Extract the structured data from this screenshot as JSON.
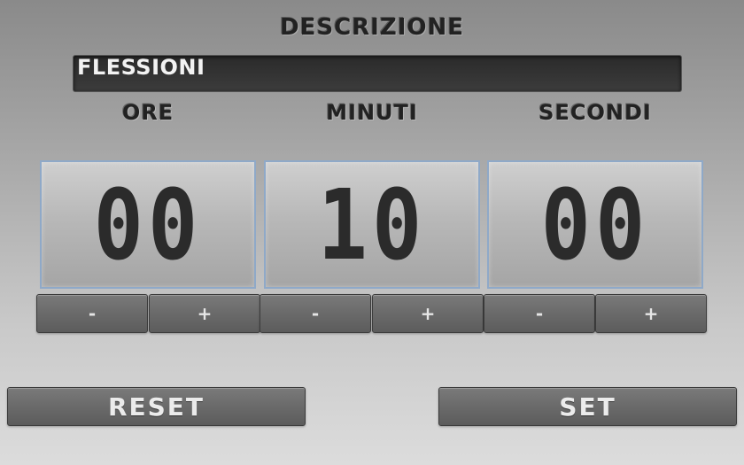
{
  "description": {
    "label": "DESCRIZIONE",
    "value": "FLESSIONI"
  },
  "timer": {
    "columns": [
      {
        "label": "ORE",
        "value": "00",
        "minus": "-",
        "plus": "+"
      },
      {
        "label": "MINUTI",
        "value": "10",
        "minus": "-",
        "plus": "+"
      },
      {
        "label": "SECONDI",
        "value": "00",
        "minus": "-",
        "plus": "+"
      }
    ]
  },
  "actions": {
    "reset_label": "RESET",
    "set_label": "SET"
  },
  "colors": {
    "panel_border": "#8fa9c8",
    "digits": "#2b2b2b",
    "field_bg": "#2a2a2a"
  }
}
